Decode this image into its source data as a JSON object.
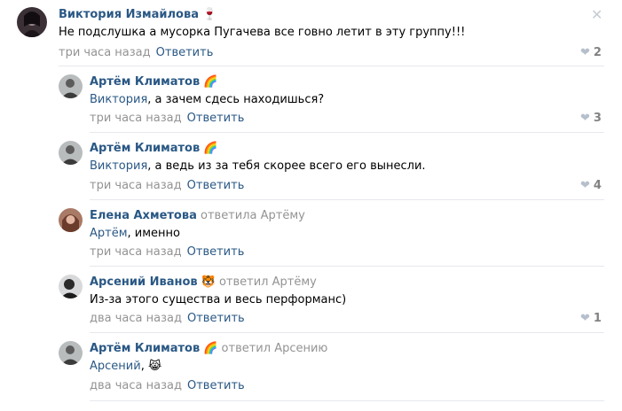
{
  "comments": [
    {
      "author": "Виктория Измайлова",
      "author_emoji": "🍷",
      "replied_to": "",
      "mention": "",
      "text": "Не подслушка а мусорка Пугачева все говно летит в эту группу!!!",
      "time": "три часа назад",
      "reply_label": "Ответить",
      "likes": "2"
    },
    {
      "author": "Артём Климатов",
      "author_emoji": "🌈",
      "replied_to": "",
      "mention": "Виктория",
      "text": ", а зачем сдесь находишься?",
      "time": "три часа назад",
      "reply_label": "Ответить",
      "likes": "3"
    },
    {
      "author": "Артём Климатов",
      "author_emoji": "🌈",
      "replied_to": "",
      "mention": "Виктория",
      "text": ", а ведь из за тебя скорее всего его вынесли.",
      "time": "три часа назад",
      "reply_label": "Ответить",
      "likes": "4"
    },
    {
      "author": "Елена Ахметова",
      "author_emoji": "",
      "replied_to": "ответила Артёму",
      "mention": "Артём",
      "text": ", именно",
      "time": "три часа назад",
      "reply_label": "Ответить",
      "likes": ""
    },
    {
      "author": "Арсений Иванов",
      "author_emoji": "🐯",
      "replied_to": "ответил Артёму",
      "mention": "",
      "text": "Из-за этого существа и весь перформанс)",
      "time": "два часа назад",
      "reply_label": "Ответить",
      "likes": "1"
    },
    {
      "author": "Артём Климатов",
      "author_emoji": "🌈",
      "replied_to": "ответил Арсению",
      "mention": "Арсений",
      "text": ", 😹",
      "time": "два часа назад",
      "reply_label": "Ответить",
      "likes": ""
    }
  ],
  "close_icon": "close-icon",
  "like_icon": "heart-icon",
  "colors": {
    "link": "#2a5885",
    "muted": "#939393",
    "heart": "#b6c0cc",
    "separator": "#e7e8ec"
  }
}
